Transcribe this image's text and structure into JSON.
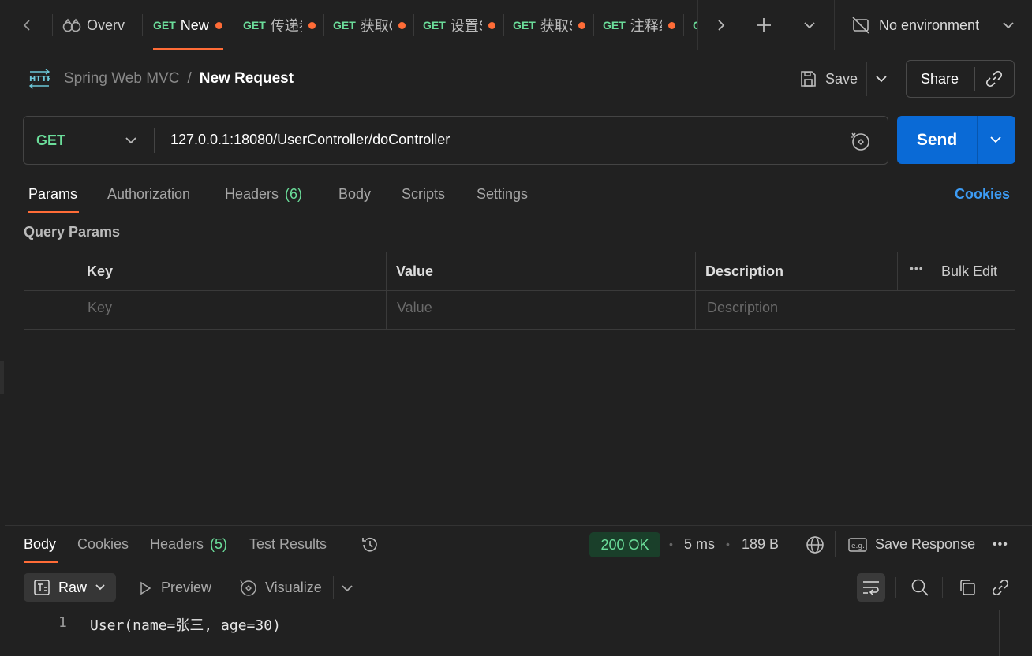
{
  "tabs": {
    "overview_label": "Overv",
    "items": [
      {
        "method": "GET",
        "title": "New"
      },
      {
        "method": "GET",
        "title": "传递参"
      },
      {
        "method": "GET",
        "title": "获取C"
      },
      {
        "method": "GET",
        "title": "设置S"
      },
      {
        "method": "GET",
        "title": "获取S"
      },
      {
        "method": "GET",
        "title": "注释组"
      }
    ],
    "environment": "No environment"
  },
  "breadcrumb": {
    "collection": "Spring Web MVC",
    "separator": "/",
    "request": "New Request"
  },
  "toolbar": {
    "save_label": "Save",
    "share_label": "Share"
  },
  "request": {
    "method": "GET",
    "url": "127.0.0.1:18080/UserController/doController",
    "send_label": "Send"
  },
  "request_tabs": {
    "params": "Params",
    "authorization": "Authorization",
    "headers": "Headers",
    "headers_count": "(6)",
    "body": "Body",
    "scripts": "Scripts",
    "settings": "Settings",
    "cookies": "Cookies"
  },
  "query_params": {
    "title": "Query Params",
    "columns": {
      "key": "Key",
      "value": "Value",
      "description": "Description",
      "bulk_edit": "Bulk Edit"
    },
    "placeholders": {
      "key": "Key",
      "value": "Value",
      "description": "Description"
    }
  },
  "response": {
    "tabs": {
      "body": "Body",
      "cookies": "Cookies",
      "headers": "Headers",
      "headers_count": "(5)",
      "test_results": "Test Results"
    },
    "status": "200 OK",
    "time": "5 ms",
    "size": "189 B",
    "save_response": "Save Response",
    "format": {
      "raw": "Raw",
      "preview": "Preview",
      "visualize": "Visualize"
    },
    "lines": [
      {
        "num": "1",
        "text": "User(name=张三, age=30)"
      }
    ]
  },
  "colors": {
    "accent": "#ff6c37",
    "method_get": "#6bdd9a",
    "send": "#0a6ad6",
    "link": "#3d9cf5"
  }
}
